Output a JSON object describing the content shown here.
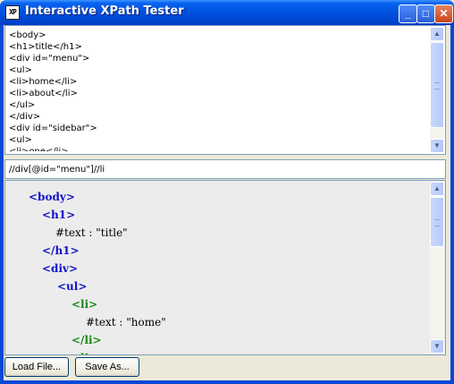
{
  "window": {
    "title": "Interactive XPath Tester",
    "icon_text": "XP",
    "minimize": "_",
    "maximize": "□",
    "close": "✕"
  },
  "xml_source": {
    "lines": [
      "<body>",
      "<h1>title</h1>",
      "<div id=\"menu\">",
      "<ul>",
      "<li>home</li>",
      "<li>about</li>",
      "</ul>",
      "</div>",
      "<div id=\"sidebar\">",
      "<ul>",
      "<li>one</li>"
    ]
  },
  "xpath": {
    "value": "//div[@id=\"menu\"]//li"
  },
  "result_tree": {
    "nodes": [
      {
        "text": "<body>",
        "style": "blue"
      },
      {
        "text": "<h1>",
        "style": "blue"
      },
      {
        "text": "#text : \"title\"",
        "style": "text"
      },
      {
        "text": "</h1>",
        "style": "blue"
      },
      {
        "text": "<div>",
        "style": "blue"
      },
      {
        "text": "<ul>",
        "style": "blue"
      },
      {
        "text": "<li>",
        "style": "green"
      },
      {
        "text": "#text : \"home\"",
        "style": "text"
      },
      {
        "text": "</li>",
        "style": "green"
      },
      {
        "text": "<li>",
        "style": "green"
      }
    ]
  },
  "footer": {
    "load_label": "Load File...",
    "save_label": "Save As..."
  },
  "scroll_icons": {
    "up": "▲",
    "down": "▼"
  }
}
